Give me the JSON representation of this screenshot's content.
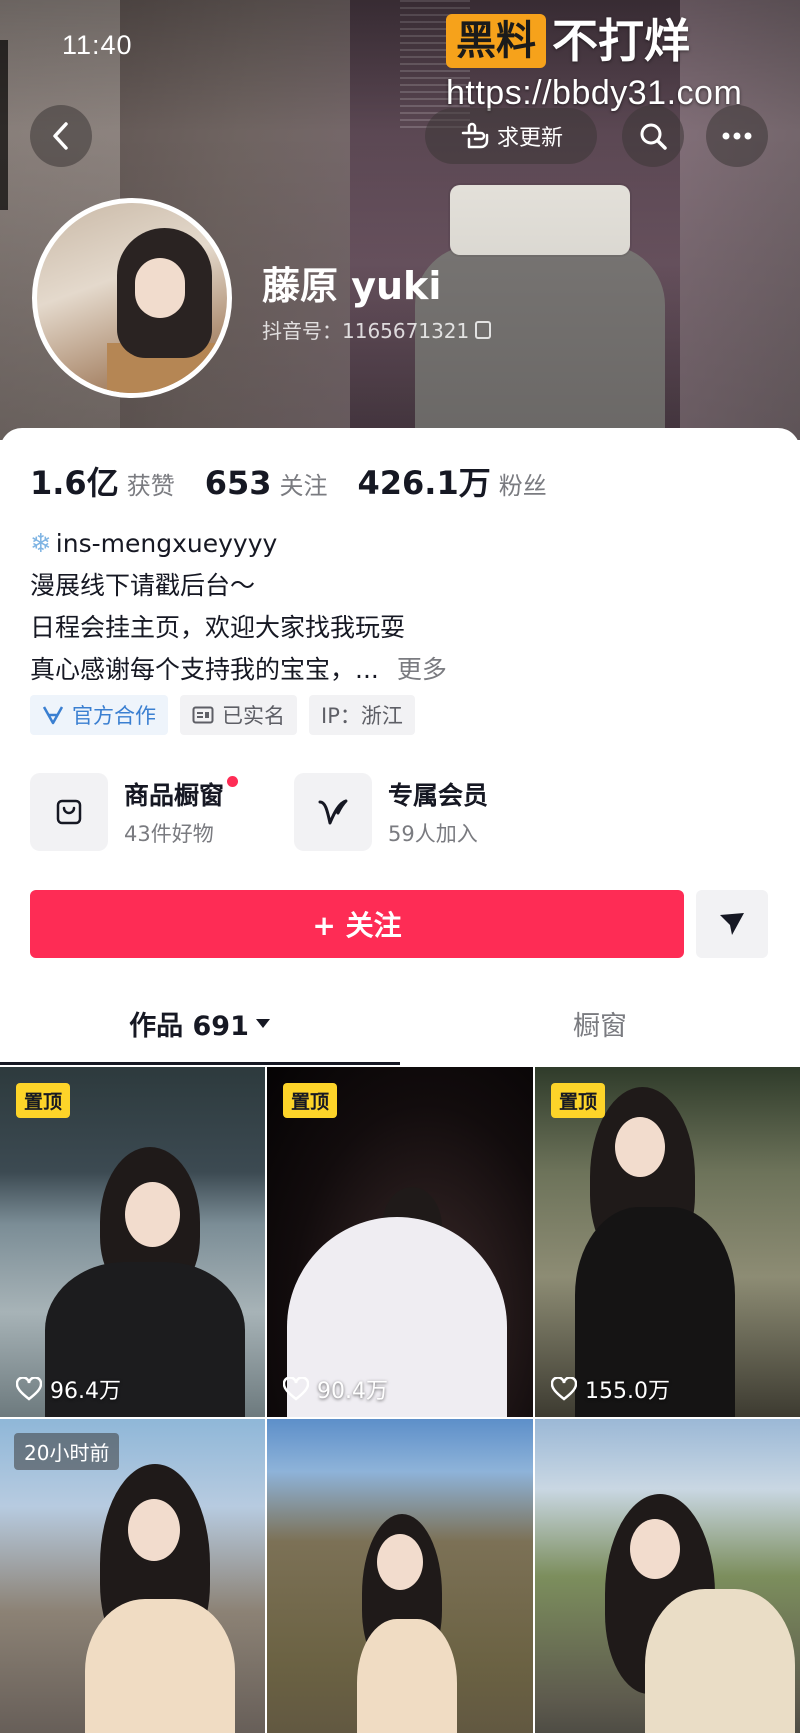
{
  "status_bar": {
    "time": "11:40"
  },
  "watermark": {
    "badge": "黑料",
    "text": "不打烊",
    "url": "https://bbdy31.com"
  },
  "header": {
    "update_label": "求更新"
  },
  "profile": {
    "name": "藤原 yuki",
    "douyin_id": "抖音号：1165671321"
  },
  "stats": [
    {
      "value": "1.6亿",
      "label": "获赞"
    },
    {
      "value": "653",
      "label": "关注"
    },
    {
      "value": "426.1万",
      "label": "粉丝"
    }
  ],
  "bio": {
    "line1": "ins-mengxueyyyy",
    "line2": "漫展线下请戳后台～",
    "line3": "日程会挂主页，欢迎大家找我玩耍",
    "line4": "真心感谢每个支持我的宝宝，...",
    "more": "更多"
  },
  "tags": [
    {
      "label": "官方合作"
    },
    {
      "label": "已实名"
    },
    {
      "label": "IP：浙江"
    }
  ],
  "services": [
    {
      "title": "商品橱窗",
      "subtitle": "43件好物"
    },
    {
      "title": "专属会员",
      "subtitle": "59人加入"
    }
  ],
  "follow_label": "+ 关注",
  "tabs": [
    {
      "label": "作品 691"
    },
    {
      "label": "橱窗"
    }
  ],
  "videos": [
    {
      "badge": "置顶",
      "likes": "96.4万"
    },
    {
      "badge": "置顶",
      "likes": "90.4万"
    },
    {
      "badge": "置顶",
      "likes": "155.0万"
    },
    {
      "badge": "20小时前",
      "likes": ""
    },
    {
      "badge": "",
      "likes": ""
    },
    {
      "badge": "",
      "likes": ""
    }
  ],
  "colors": {
    "accent": "#fe2c55",
    "pin_badge": "#fdd429",
    "official_blue": "#3a7fd1"
  }
}
